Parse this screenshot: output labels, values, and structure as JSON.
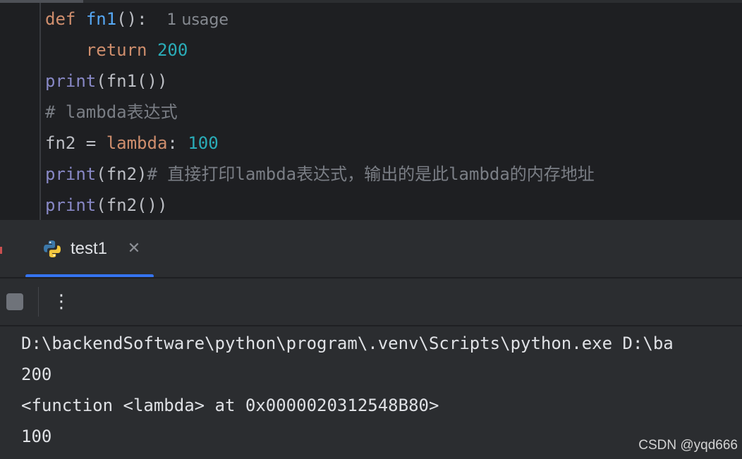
{
  "editor": {
    "lines": {
      "l1": {
        "kw": "def",
        "name": "fn1",
        "rest": "():",
        "hint": "1 usage"
      },
      "l2": {
        "kw": "return",
        "num": "200"
      },
      "l3": {
        "builtin": "print",
        "rest": "(fn1())"
      },
      "l4": {
        "comment": "# lambda表达式"
      },
      "l5": {
        "lhs": "fn2 = ",
        "kw": "lambda",
        "colon": ": ",
        "num": "100"
      },
      "l6": {
        "builtin": "print",
        "rest": "(fn2)",
        "comment": "# 直接打印lambda表达式，输出的是此lambda的内存地址"
      },
      "l7": {
        "builtin": "print",
        "rest": "(fn2())"
      }
    }
  },
  "run_panel": {
    "tab": {
      "label": "test1",
      "icon": "python-icon",
      "close_icon": "close-icon"
    },
    "toolbar": {
      "stop_icon": "stop-icon",
      "more_icon": "more-vertical-icon"
    },
    "console_lines": [
      "D:\\backendSoftware\\python\\program\\.venv\\Scripts\\python.exe D:\\ba",
      "200",
      "<function <lambda> at 0x0000020312548B80>",
      "100"
    ]
  },
  "watermark": "CSDN @yqd666",
  "colors": {
    "editor_bg": "#1e1f22",
    "panel_bg": "#2b2d30",
    "keyword": "#cf8e6d",
    "function": "#56a8f5",
    "number": "#2aacb8",
    "builtin": "#8888c6",
    "comment": "#7a7e85",
    "tab_underline": "#3574f0"
  }
}
